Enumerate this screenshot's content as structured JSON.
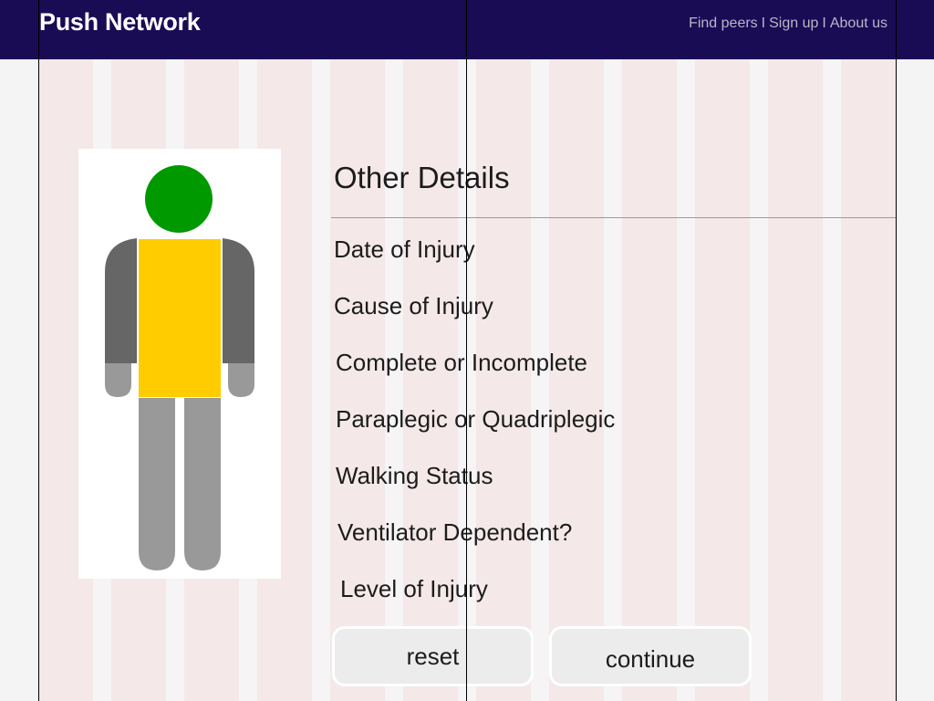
{
  "header": {
    "brand": "Push Network",
    "nav": {
      "find_peers": "Find peers",
      "sign_up": "Sign up",
      "about_us": "About us",
      "separator": "I"
    }
  },
  "figure": {
    "head_color": "#009900",
    "torso_color": "#ffcc00",
    "arm_color": "#666666",
    "hand_color": "#999999",
    "leg_color": "#999999"
  },
  "details": {
    "title": "Other Details",
    "items": [
      "Date of Injury",
      "Cause of Injury",
      "Complete or Incomplete",
      "Paraplegic or Quadriplegic",
      "Walking Status",
      "Ventilator Dependent?",
      "Level of Injury"
    ]
  },
  "buttons": {
    "reset": "reset",
    "continue": "continue"
  },
  "colors": {
    "header_bg": "#1a0b55",
    "page_bg": "#f4f4f4",
    "stripe": "#f4e8e8"
  }
}
